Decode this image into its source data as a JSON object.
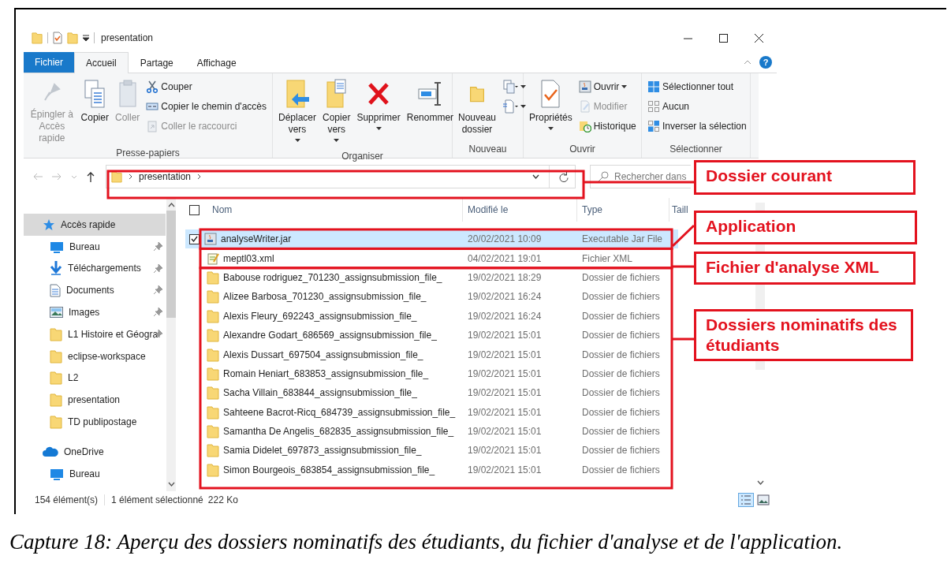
{
  "window": {
    "title": "presentation",
    "help": "?"
  },
  "ribbon": {
    "tabs": [
      {
        "label": "Fichier",
        "kind": "file",
        "selected": false
      },
      {
        "label": "Accueil",
        "kind": "tab",
        "selected": true
      },
      {
        "label": "Partage",
        "kind": "tab",
        "selected": false
      },
      {
        "label": "Affichage",
        "kind": "tab",
        "selected": false
      }
    ],
    "groups": [
      {
        "label": "Presse-papiers",
        "items": [
          {
            "kind": "large",
            "label": "Épingler à\nAccès rapide",
            "disabled": true,
            "dropdown": false
          },
          {
            "kind": "large",
            "label": "Copier",
            "disabled": false,
            "dropdown": false
          },
          {
            "kind": "large",
            "label": "Coller",
            "disabled": true,
            "dropdown": false
          },
          {
            "kind": "small",
            "label": "Couper",
            "disabled": false,
            "dropdown": false
          },
          {
            "kind": "small",
            "label": "Copier le chemin d'accès",
            "disabled": false,
            "dropdown": false
          },
          {
            "kind": "small",
            "label": "Coller le raccourci",
            "disabled": true,
            "dropdown": false
          }
        ]
      },
      {
        "label": "Organiser",
        "items": [
          {
            "kind": "large",
            "label": "Déplacer\nvers",
            "disabled": false,
            "dropdown": true
          },
          {
            "kind": "large",
            "label": "Copier\nvers",
            "disabled": false,
            "dropdown": true
          },
          {
            "kind": "large",
            "label": "Supprimer",
            "disabled": false,
            "dropdown": true
          },
          {
            "kind": "large",
            "label": "Renommer",
            "disabled": false,
            "dropdown": false
          }
        ]
      },
      {
        "label": "Nouveau",
        "items": [
          {
            "kind": "large",
            "label": "Nouveau\ndossier",
            "disabled": false,
            "dropdown": false
          },
          {
            "kind": "icon",
            "disabled": false,
            "dropdown": true
          },
          {
            "kind": "icon",
            "disabled": false,
            "dropdown": true
          }
        ]
      },
      {
        "label": "Ouvrir",
        "items": [
          {
            "kind": "large",
            "label": "Propriétés",
            "disabled": false,
            "dropdown": true
          },
          {
            "kind": "small",
            "label": "Ouvrir",
            "disabled": false,
            "dropdown": true
          },
          {
            "kind": "small",
            "label": "Modifier",
            "disabled": true,
            "dropdown": false
          },
          {
            "kind": "small",
            "label": "Historique",
            "disabled": false,
            "dropdown": false
          }
        ]
      },
      {
        "label": "Sélectionner",
        "items": [
          {
            "kind": "small",
            "label": "Sélectionner tout",
            "disabled": false,
            "dropdown": false
          },
          {
            "kind": "small",
            "label": "Aucun",
            "disabled": false,
            "dropdown": false
          },
          {
            "kind": "small",
            "label": "Inverser la sélection",
            "disabled": false,
            "dropdown": false
          }
        ]
      }
    ]
  },
  "address": {
    "path": [
      "presentation"
    ],
    "search_placeholder": "Rechercher dans"
  },
  "sidebar": {
    "items": [
      {
        "label": "Accès rapide",
        "kind": "quick",
        "selected": true,
        "pinned": false,
        "children": [
          {
            "label": "Bureau",
            "kind": "desktop",
            "selected": false,
            "pinned": true
          },
          {
            "label": "Téléchargements",
            "kind": "downloads",
            "selected": false,
            "pinned": true
          },
          {
            "label": "Documents",
            "kind": "documents",
            "selected": false,
            "pinned": true
          },
          {
            "label": "Images",
            "kind": "pictures",
            "selected": false,
            "pinned": true
          },
          {
            "label": "L1 Histoire et Géogra",
            "kind": "folder",
            "selected": false,
            "pinned": true
          },
          {
            "label": "eclipse-workspace",
            "kind": "folder",
            "selected": false,
            "pinned": false
          },
          {
            "label": "L2",
            "kind": "folder",
            "selected": false,
            "pinned": false
          },
          {
            "label": "presentation",
            "kind": "folder",
            "selected": false,
            "pinned": false
          },
          {
            "label": "TD publipostage",
            "kind": "folder",
            "selected": false,
            "pinned": false
          }
        ]
      },
      {
        "label": "OneDrive",
        "kind": "cloud",
        "selected": false,
        "pinned": false,
        "children": [
          {
            "label": "Bureau",
            "kind": "desktop",
            "selected": false,
            "pinned": false
          }
        ]
      }
    ]
  },
  "table": {
    "columns": [
      "Nom",
      "Modifié le",
      "Type",
      "Taill"
    ],
    "header_checkbox": {
      "checked": false
    },
    "rows": [
      {
        "name": "analyseWriter.jar",
        "modified": "20/02/2021 10:09",
        "type": "Executable Jar File",
        "kind": "jar",
        "selected": true
      },
      {
        "name": "meptl03.xml",
        "modified": "04/02/2021 19:01",
        "type": "Fichier XML",
        "kind": "xml",
        "selected": false
      },
      {
        "name": "Babouse rodriguez_701230_assignsubmission_file_",
        "modified": "19/02/2021 18:29",
        "type": "Dossier de fichiers",
        "kind": "folder",
        "selected": false
      },
      {
        "name": "Alizee Barbosa_701230_assignsubmission_file_",
        "modified": "19/02/2021 16:24",
        "type": "Dossier de fichiers",
        "kind": "folder",
        "selected": false
      },
      {
        "name": "Alexis Fleury_692243_assignsubmission_file_",
        "modified": "19/02/2021 16:24",
        "type": "Dossier de fichiers",
        "kind": "folder",
        "selected": false
      },
      {
        "name": "Alexandre Godart_686569_assignsubmission_file_",
        "modified": "19/02/2021 15:01",
        "type": "Dossier de fichiers",
        "kind": "folder",
        "selected": false
      },
      {
        "name": "Alexis Dussart_697504_assignsubmission_file_",
        "modified": "19/02/2021 15:01",
        "type": "Dossier de fichiers",
        "kind": "folder",
        "selected": false
      },
      {
        "name": "Romain Heniart_683853_assignsubmission_file_",
        "modified": "19/02/2021 15:01",
        "type": "Dossier de fichiers",
        "kind": "folder",
        "selected": false
      },
      {
        "name": "Sacha Villain_683844_assignsubmission_file_",
        "modified": "19/02/2021 15:01",
        "type": "Dossier de fichiers",
        "kind": "folder",
        "selected": false
      },
      {
        "name": "Sahteene Bacrot-Ricq_684739_assignsubmission_file_",
        "modified": "19/02/2021 15:01",
        "type": "Dossier de fichiers",
        "kind": "folder",
        "selected": false
      },
      {
        "name": "Samantha De Angelis_682835_assignsubmission_file_",
        "modified": "19/02/2021 15:01",
        "type": "Dossier de fichiers",
        "kind": "folder",
        "selected": false
      },
      {
        "name": "Samia Didelet_697873_assignsubmission_file_",
        "modified": "19/02/2021 15:01",
        "type": "Dossier de fichiers",
        "kind": "folder",
        "selected": false
      },
      {
        "name": "Simon Bourgeois_683854_assignsubmission_file_",
        "modified": "19/02/2021 15:01",
        "type": "Dossier de fichiers",
        "kind": "folder",
        "selected": false
      }
    ]
  },
  "status_bar": {
    "count": "154 élément(s)",
    "selection": "1 élément sélectionné",
    "size": "222 Ko"
  },
  "callouts": [
    {
      "label": "Dossier courant"
    },
    {
      "label": "Application"
    },
    {
      "label": "Fichier d'analyse XML"
    },
    {
      "label": "Dossiers nominatifs des étudiants"
    }
  ],
  "caption": "Capture 18: Aperçu des dossiers nominatifs des étudiants, du fichier d'analyse et de l'application."
}
